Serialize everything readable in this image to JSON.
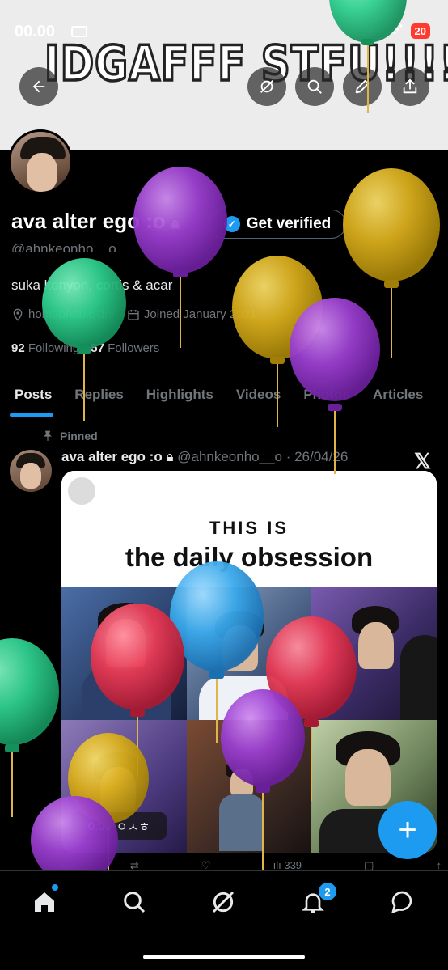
{
  "status_bar": {
    "time": "00.00",
    "battery": "20"
  },
  "banner": {
    "text": "IDGAFFF STFU!!!!!"
  },
  "toolbar": {
    "back_icon": "back-arrow-icon",
    "grok_icon": "grok-icon",
    "search_icon": "search-icon",
    "edit_icon": "pencil-icon",
    "share_icon": "share-icon"
  },
  "profile": {
    "display_name": "ava alter ego :o",
    "handle": "@ahnkeonho__o",
    "verify_button": "Get verified",
    "bio": "suka konyon, cortis & acar",
    "location": "homophobic dni",
    "joined": "Joined January 2021",
    "following_count": "92",
    "following_label": "Following",
    "followers_count": "57",
    "followers_label": "Followers"
  },
  "tabs": [
    {
      "label": "Posts",
      "active": true
    },
    {
      "label": "Replies",
      "active": false
    },
    {
      "label": "Highlights",
      "active": false
    },
    {
      "label": "Videos",
      "active": false
    },
    {
      "label": "Photos",
      "active": false
    },
    {
      "label": "Articles",
      "active": false
    }
  ],
  "post": {
    "pinned_label": "Pinned",
    "author": "ava alter ego :o",
    "meta": "@ahnkeonho__o · 26/04/26",
    "media_line1": "THIS IS",
    "media_line2": "the daily obsession",
    "video_time": "0:09",
    "video_caption": "ㅇㅅㅎ",
    "views": "339"
  },
  "bottom_nav": {
    "notif_count": "2"
  },
  "colors": {
    "accent": "#1d9bf0",
    "background": "#000000",
    "muted_text": "#71767b"
  }
}
